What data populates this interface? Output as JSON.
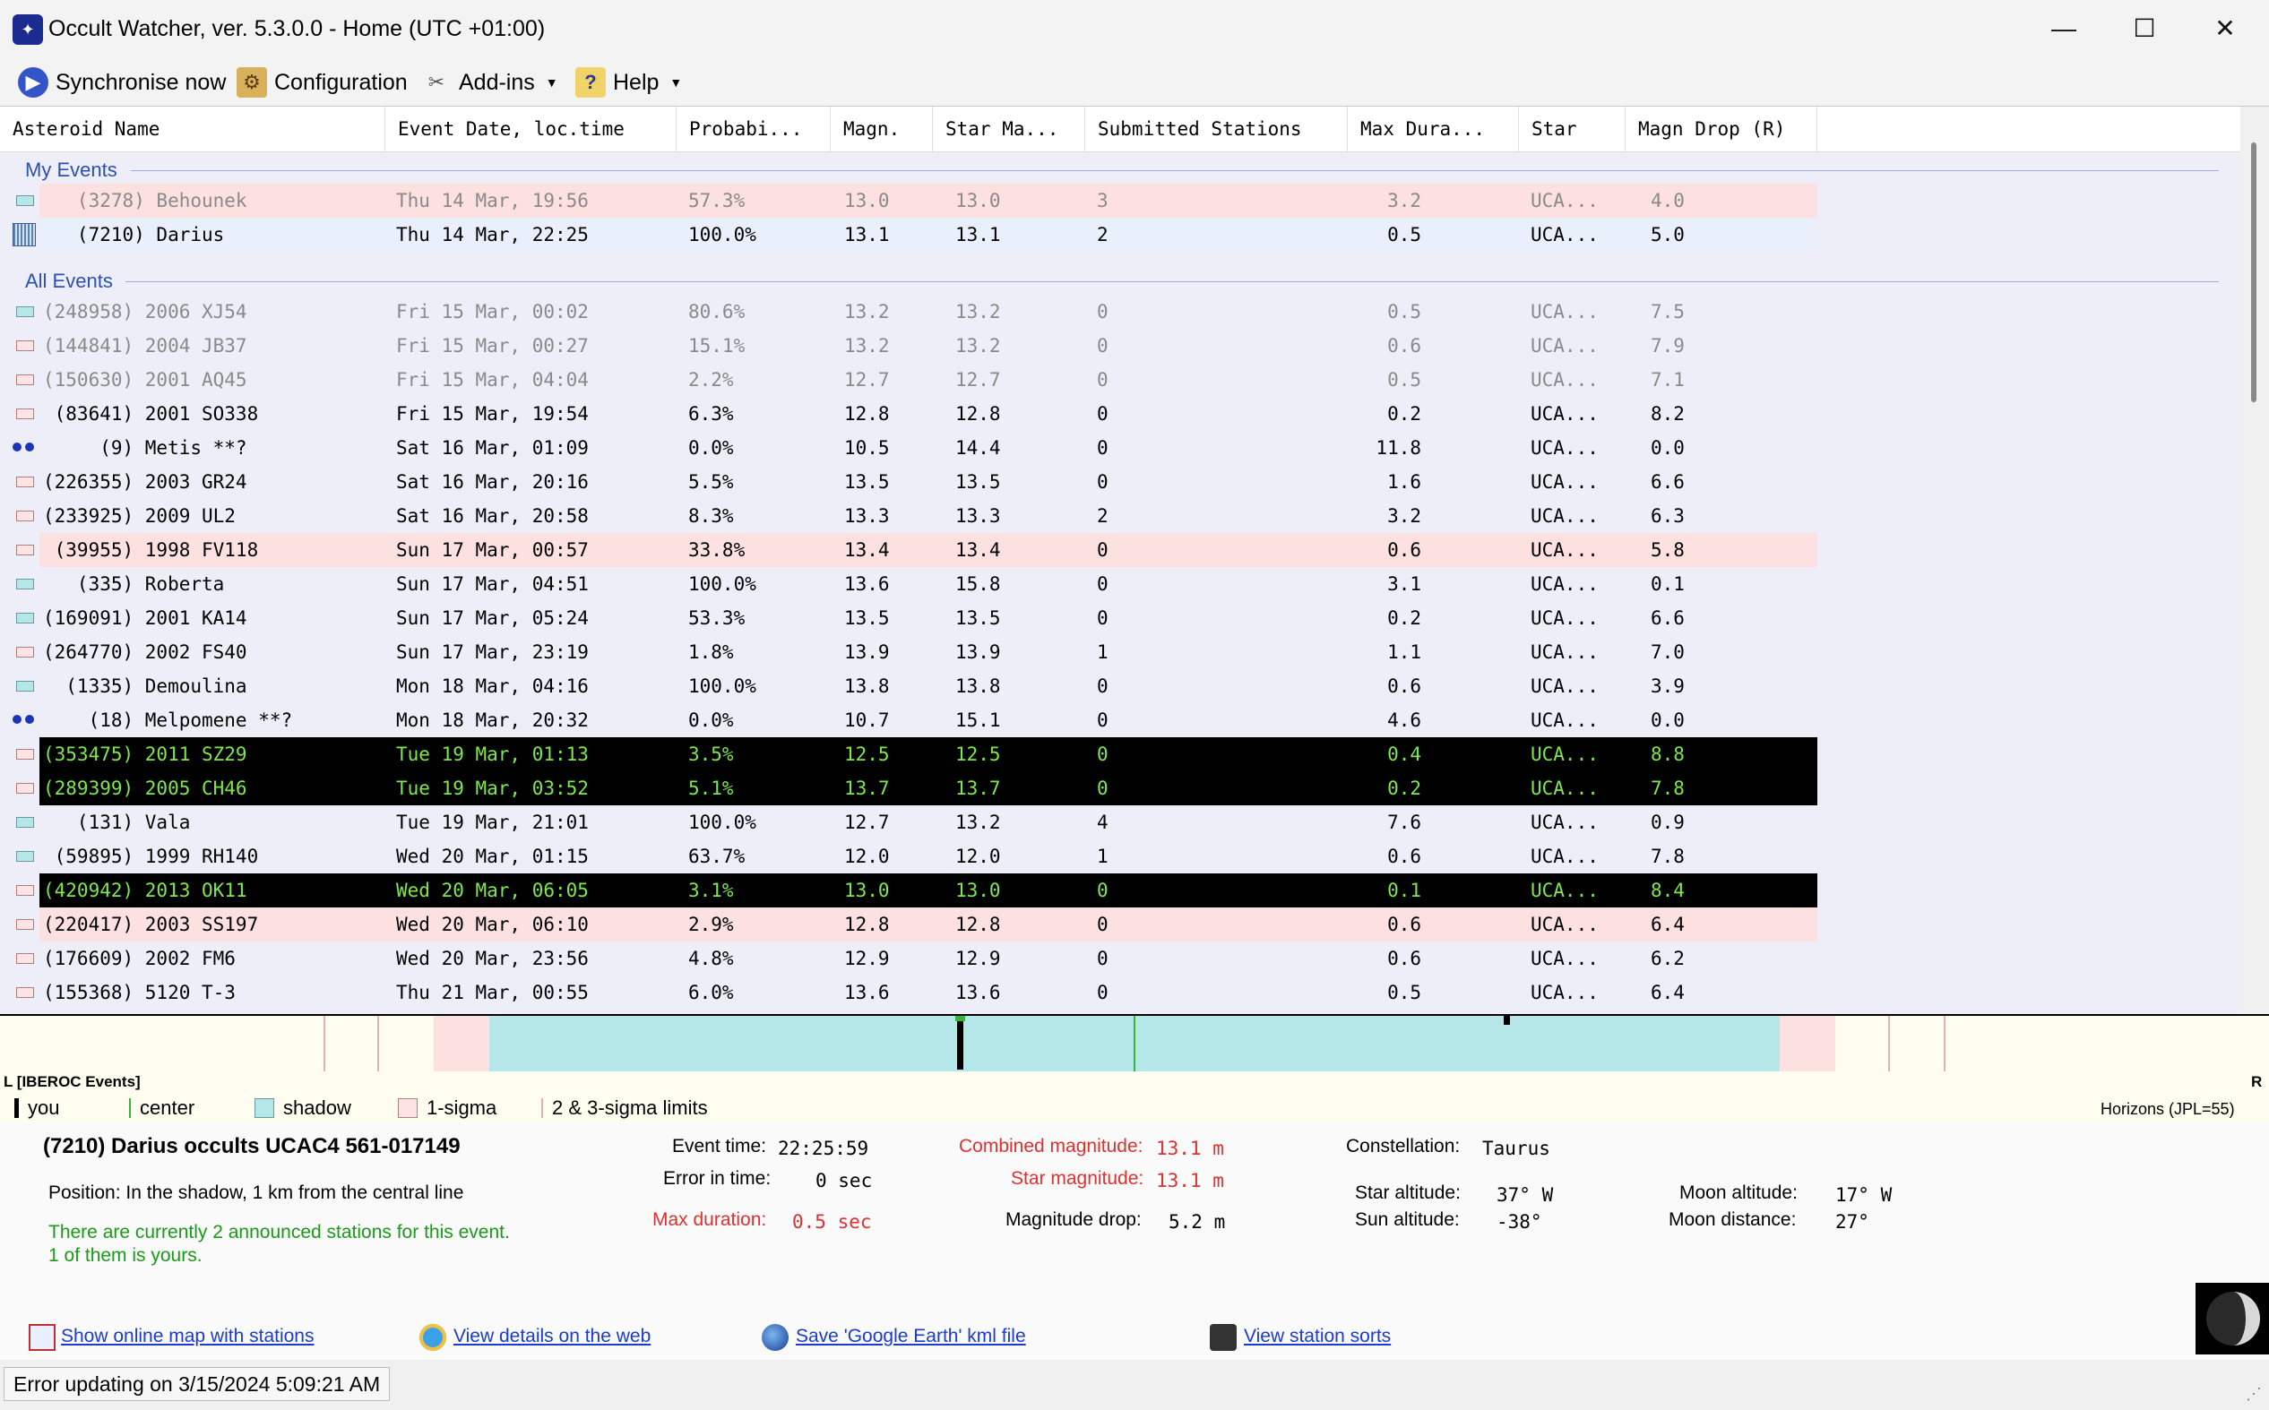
{
  "window": {
    "title": "Occult Watcher, ver. 5.3.0.0 - Home (UTC +01:00)",
    "app_icon": "star-icon",
    "minimize": "—",
    "maximize": "☐",
    "close": "✕"
  },
  "toolbar": {
    "sync_label": "Synchronise now",
    "config_label": "Configuration",
    "addins_label": "Add-ins",
    "help_label": "Help"
  },
  "grid": {
    "columns": [
      "Asteroid Name",
      "Event Date, loc.time",
      "Probabi...",
      "Magn.",
      "Star Ma...",
      "Submitted Stations",
      "Max Dura...",
      "Star",
      "Magn Drop (R)"
    ],
    "group_my": "My Events",
    "group_all": "All Events",
    "my_rows": [
      {
        "marker": "shadow",
        "bg": "pink",
        "dim": true,
        "name": "   (3278) Behounek",
        "date": "Thu 14 Mar, 19:56",
        "prob": "57.3%",
        "magn": "13.0",
        "starmag": "13.0",
        "stations": "3",
        "dur": "3.2",
        "star": "UCA...",
        "drop": "4.0"
      },
      {
        "marker": "my",
        "bg": "lightblue",
        "dim": false,
        "name": "   (7210) Darius",
        "date": "Thu 14 Mar, 22:25",
        "prob": "100.0%",
        "magn": "13.1",
        "starmag": "13.1",
        "stations": "2",
        "dur": "0.5",
        "star": "UCA...",
        "drop": "5.0"
      }
    ],
    "all_rows": [
      {
        "marker": "shadow",
        "bg": "none",
        "dim": true,
        "name": "(248958) 2006 XJ54",
        "date": "Fri 15 Mar, 00:02",
        "prob": "80.6%",
        "magn": "13.2",
        "starmag": "13.2",
        "stations": "0",
        "dur": "0.5",
        "star": "UCA...",
        "drop": "7.5"
      },
      {
        "marker": "sigma",
        "bg": "none",
        "dim": true,
        "name": "(144841) 2004 JB37",
        "date": "Fri 15 Mar, 00:27",
        "prob": "15.1%",
        "magn": "13.2",
        "starmag": "13.2",
        "stations": "0",
        "dur": "0.6",
        "star": "UCA...",
        "drop": "7.9"
      },
      {
        "marker": "sigma",
        "bg": "none",
        "dim": true,
        "name": "(150630) 2001 AQ45",
        "date": "Fri 15 Mar, 04:04",
        "prob": "2.2%",
        "magn": "12.7",
        "starmag": "12.7",
        "stations": "0",
        "dur": "0.5",
        "star": "UCA...",
        "drop": "7.1"
      },
      {
        "marker": "sigma",
        "bg": "none",
        "dim": false,
        "name": " (83641) 2001 SO338",
        "date": "Fri 15 Mar, 19:54",
        "prob": "6.3%",
        "magn": "12.8",
        "starmag": "12.8",
        "stations": "0",
        "dur": "0.2",
        "star": "UCA...",
        "drop": "8.2"
      },
      {
        "marker": "binary",
        "bg": "none",
        "dim": false,
        "name": "     (9) Metis **?",
        "date": "Sat 16 Mar, 01:09",
        "prob": "0.0%",
        "magn": "10.5",
        "starmag": "14.4",
        "stations": "0",
        "dur": "11.8",
        "star": "UCA...",
        "drop": "0.0"
      },
      {
        "marker": "sigma",
        "bg": "none",
        "dim": false,
        "name": "(226355) 2003 GR24",
        "date": "Sat 16 Mar, 20:16",
        "prob": "5.5%",
        "magn": "13.5",
        "starmag": "13.5",
        "stations": "0",
        "dur": "1.6",
        "star": "UCA...",
        "drop": "6.6"
      },
      {
        "marker": "sigma",
        "bg": "none",
        "dim": false,
        "name": "(233925) 2009 UL2",
        "date": "Sat 16 Mar, 20:58",
        "prob": "8.3%",
        "magn": "13.3",
        "starmag": "13.3",
        "stations": "2",
        "dur": "3.2",
        "star": "UCA...",
        "drop": "6.3"
      },
      {
        "marker": "sigma",
        "bg": "pink",
        "dim": false,
        "name": " (39955) 1998 FV118",
        "date": "Sun 17 Mar, 00:57",
        "prob": "33.8%",
        "magn": "13.4",
        "starmag": "13.4",
        "stations": "0",
        "dur": "0.6",
        "star": "UCA...",
        "drop": "5.8"
      },
      {
        "marker": "shadow",
        "bg": "none",
        "dim": false,
        "name": "   (335) Roberta",
        "date": "Sun 17 Mar, 04:51",
        "prob": "100.0%",
        "magn": "13.6",
        "starmag": "15.8",
        "stations": "0",
        "dur": "3.1",
        "star": "UCA...",
        "drop": "0.1"
      },
      {
        "marker": "shadow",
        "bg": "none",
        "dim": false,
        "name": "(169091) 2001 KA14",
        "date": "Sun 17 Mar, 05:24",
        "prob": "53.3%",
        "magn": "13.5",
        "starmag": "13.5",
        "stations": "0",
        "dur": "0.2",
        "star": "UCA...",
        "drop": "6.6"
      },
      {
        "marker": "sigma",
        "bg": "none",
        "dim": false,
        "name": "(264770) 2002 FS40",
        "date": "Sun 17 Mar, 23:19",
        "prob": "1.8%",
        "magn": "13.9",
        "starmag": "13.9",
        "stations": "1",
        "dur": "1.1",
        "star": "UCA...",
        "drop": "7.0"
      },
      {
        "marker": "shadow",
        "bg": "none",
        "dim": false,
        "name": "  (1335) Demoulina",
        "date": "Mon 18 Mar, 04:16",
        "prob": "100.0%",
        "magn": "13.8",
        "starmag": "13.8",
        "stations": "0",
        "dur": "0.6",
        "star": "UCA...",
        "drop": "3.9"
      },
      {
        "marker": "binary",
        "bg": "none",
        "dim": false,
        "name": "    (18) Melpomene **?",
        "date": "Mon 18 Mar, 20:32",
        "prob": "0.0%",
        "magn": "10.7",
        "starmag": "15.1",
        "stations": "0",
        "dur": "4.6",
        "star": "UCA...",
        "drop": "0.0"
      },
      {
        "marker": "sigma",
        "bg": "black",
        "dim": false,
        "name": "(353475) 2011 SZ29",
        "date": "Tue 19 Mar, 01:13",
        "prob": "3.5%",
        "magn": "12.5",
        "starmag": "12.5",
        "stations": "0",
        "dur": "0.4",
        "star": "UCA...",
        "drop": "8.8"
      },
      {
        "marker": "sigma",
        "bg": "black",
        "dim": false,
        "name": "(289399) 2005 CH46",
        "date": "Tue 19 Mar, 03:52",
        "prob": "5.1%",
        "magn": "13.7",
        "starmag": "13.7",
        "stations": "0",
        "dur": "0.2",
        "star": "UCA...",
        "drop": "7.8"
      },
      {
        "marker": "shadow",
        "bg": "none",
        "dim": false,
        "name": "   (131) Vala",
        "date": "Tue 19 Mar, 21:01",
        "prob": "100.0%",
        "magn": "12.7",
        "starmag": "13.2",
        "stations": "4",
        "dur": "7.6",
        "star": "UCA...",
        "drop": "0.9"
      },
      {
        "marker": "shadow",
        "bg": "none",
        "dim": false,
        "name": " (59895) 1999 RH140",
        "date": "Wed 20 Mar, 01:15",
        "prob": "63.7%",
        "magn": "12.0",
        "starmag": "12.0",
        "stations": "1",
        "dur": "0.6",
        "star": "UCA...",
        "drop": "7.8"
      },
      {
        "marker": "sigma",
        "bg": "black",
        "dim": false,
        "name": "(420942) 2013 OK11",
        "date": "Wed 20 Mar, 06:05",
        "prob": "3.1%",
        "magn": "13.0",
        "starmag": "13.0",
        "stations": "0",
        "dur": "0.1",
        "star": "UCA...",
        "drop": "8.4"
      },
      {
        "marker": "sigma",
        "bg": "pink",
        "dim": false,
        "name": "(220417) 2003 SS197",
        "date": "Wed 20 Mar, 06:10",
        "prob": "2.9%",
        "magn": "12.8",
        "starmag": "12.8",
        "stations": "0",
        "dur": "0.6",
        "star": "UCA...",
        "drop": "6.4"
      },
      {
        "marker": "sigma",
        "bg": "none",
        "dim": false,
        "name": "(176609) 2002 FM6",
        "date": "Wed 20 Mar, 23:56",
        "prob": "4.8%",
        "magn": "12.9",
        "starmag": "12.9",
        "stations": "0",
        "dur": "0.6",
        "star": "UCA...",
        "drop": "6.2"
      },
      {
        "marker": "sigma",
        "bg": "none",
        "dim": false,
        "name": "(155368) 5120 T-3",
        "date": "Thu 21 Mar, 00:55",
        "prob": "6.0%",
        "magn": "13.6",
        "starmag": "13.6",
        "stations": "0",
        "dur": "0.5",
        "star": "UCA...",
        "drop": "6.4"
      }
    ]
  },
  "timeline": {
    "left_label": "L [IBEROC Events]",
    "right_label": "R",
    "source": "Horizons (JPL=55)",
    "legend": {
      "you": "you",
      "center": "center",
      "shadow": "shadow",
      "sigma": "1-sigma",
      "limits": "2 & 3-sigma limits"
    }
  },
  "details": {
    "heading": "(7210) Darius occults UCAC4 561-017149",
    "position": "Position:  In the shadow, 1 km from the central line",
    "announced_1": "There are currently 2 announced stations for this event.",
    "announced_2": "1 of them is yours.",
    "event_time_label": "Event time:",
    "event_time": "22:25:59",
    "error_time_label": "Error in time:",
    "error_time": "0 sec",
    "max_duration_label": "Max duration:",
    "max_duration": "0.5 sec",
    "combined_mag_label": "Combined magnitude:",
    "combined_mag": "13.1 m",
    "star_mag_label": "Star magnitude:",
    "star_mag": "13.1 m",
    "mag_drop_label": "Magnitude drop:",
    "mag_drop": "5.2 m",
    "constellation_label": "Constellation:",
    "constellation": "Taurus",
    "star_alt_label": "Star altitude:",
    "star_alt": "37° W",
    "sun_alt_label": "Sun altitude:",
    "sun_alt": "-38°",
    "moon_alt_label": "Moon altitude:",
    "moon_alt": "17° W",
    "moon_dist_label": "Moon distance:",
    "moon_dist": "27°"
  },
  "links": {
    "map": "Show online map with stations",
    "web": "View details on the web",
    "kml": "Save 'Google Earth' kml file",
    "sorts": "View station sorts"
  },
  "status": {
    "text": "Error updating on 3/15/2024 5:09:21 AM"
  },
  "colors": {
    "pink_row": "#fde0e0",
    "blue_row": "#eaf0fb",
    "black_row": "#000000",
    "highlight_text": "#7ee84a",
    "dim_text": "#8a8a8a",
    "group_header": "#2a50b8",
    "shadow": "#b6e7e8",
    "sigma": "#fde4e4"
  }
}
